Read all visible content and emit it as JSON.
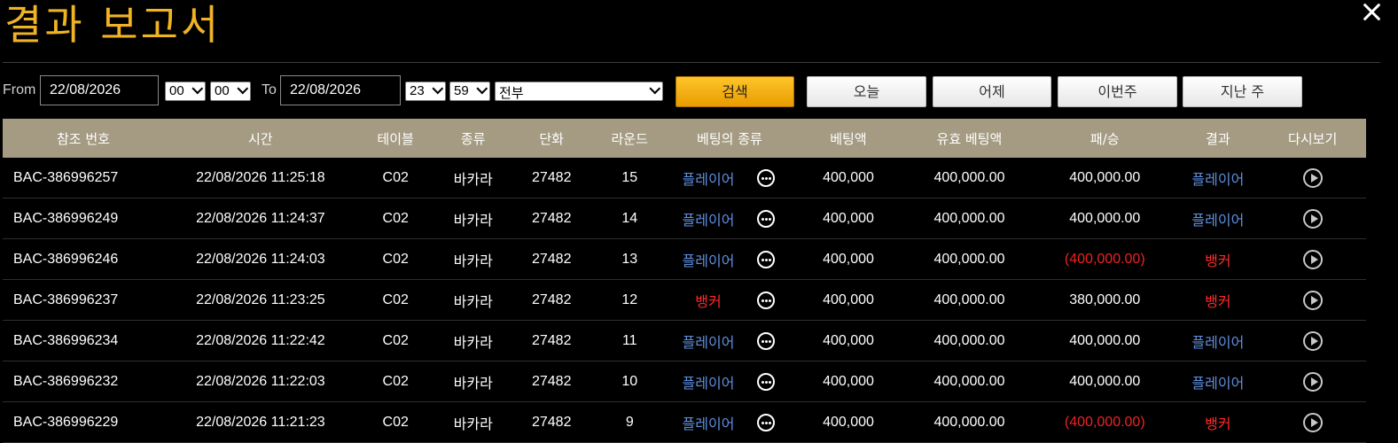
{
  "title": "결과 보고서",
  "filter": {
    "from_label": "From",
    "from_date": "22/08/2026",
    "from_hour": "00",
    "from_minute": "00",
    "to_label": "To",
    "to_date": "22/08/2026",
    "to_hour": "23",
    "to_minute": "59",
    "category": "전부",
    "search_label": "검색",
    "today_label": "오늘",
    "yesterday_label": "어제",
    "this_week_label": "이번주",
    "last_week_label": "지난 주"
  },
  "columns": [
    "참조 번호",
    "시간",
    "테이블",
    "종류",
    "단화",
    "라운드",
    "베팅의 종류",
    "베팅액",
    "유효 베팅액",
    "패/승",
    "결과",
    "다시보기"
  ],
  "colors": {
    "title": "#f0b323",
    "header_bg": "#a59b83",
    "player": "#5f8fe0",
    "banker": "#ff2a2a",
    "search_button": "#f5b300"
  },
  "rows": [
    {
      "ref": "BAC-386996257",
      "time": "22/08/2026 11:25:18",
      "table": "C02",
      "kind": "바카라",
      "shoe": "27482",
      "round": "15",
      "bet_type": "플레이어",
      "bet_type_side": "player",
      "bet": "400,000",
      "valid": "400,000.00",
      "winloss": "400,000.00",
      "winloss_negative": false,
      "result": "플레이어",
      "result_side": "player"
    },
    {
      "ref": "BAC-386996249",
      "time": "22/08/2026 11:24:37",
      "table": "C02",
      "kind": "바카라",
      "shoe": "27482",
      "round": "14",
      "bet_type": "플레이어",
      "bet_type_side": "player",
      "bet": "400,000",
      "valid": "400,000.00",
      "winloss": "400,000.00",
      "winloss_negative": false,
      "result": "플레이어",
      "result_side": "player"
    },
    {
      "ref": "BAC-386996246",
      "time": "22/08/2026 11:24:03",
      "table": "C02",
      "kind": "바카라",
      "shoe": "27482",
      "round": "13",
      "bet_type": "플레이어",
      "bet_type_side": "player",
      "bet": "400,000",
      "valid": "400,000.00",
      "winloss": "(400,000.00)",
      "winloss_negative": true,
      "result": "뱅커",
      "result_side": "banker"
    },
    {
      "ref": "BAC-386996237",
      "time": "22/08/2026 11:23:25",
      "table": "C02",
      "kind": "바카라",
      "shoe": "27482",
      "round": "12",
      "bet_type": "뱅커",
      "bet_type_side": "banker",
      "bet": "400,000",
      "valid": "400,000.00",
      "winloss": "380,000.00",
      "winloss_negative": false,
      "result": "뱅커",
      "result_side": "banker"
    },
    {
      "ref": "BAC-386996234",
      "time": "22/08/2026 11:22:42",
      "table": "C02",
      "kind": "바카라",
      "shoe": "27482",
      "round": "11",
      "bet_type": "플레이어",
      "bet_type_side": "player",
      "bet": "400,000",
      "valid": "400,000.00",
      "winloss": "400,000.00",
      "winloss_negative": false,
      "result": "플레이어",
      "result_side": "player"
    },
    {
      "ref": "BAC-386996232",
      "time": "22/08/2026 11:22:03",
      "table": "C02",
      "kind": "바카라",
      "shoe": "27482",
      "round": "10",
      "bet_type": "플레이어",
      "bet_type_side": "player",
      "bet": "400,000",
      "valid": "400,000.00",
      "winloss": "400,000.00",
      "winloss_negative": false,
      "result": "플레이어",
      "result_side": "player"
    },
    {
      "ref": "BAC-386996229",
      "time": "22/08/2026 11:21:23",
      "table": "C02",
      "kind": "바카라",
      "shoe": "27482",
      "round": "9",
      "bet_type": "플레이어",
      "bet_type_side": "player",
      "bet": "400,000",
      "valid": "400,000.00",
      "winloss": "(400,000.00)",
      "winloss_negative": true,
      "result": "뱅커",
      "result_side": "banker"
    }
  ]
}
